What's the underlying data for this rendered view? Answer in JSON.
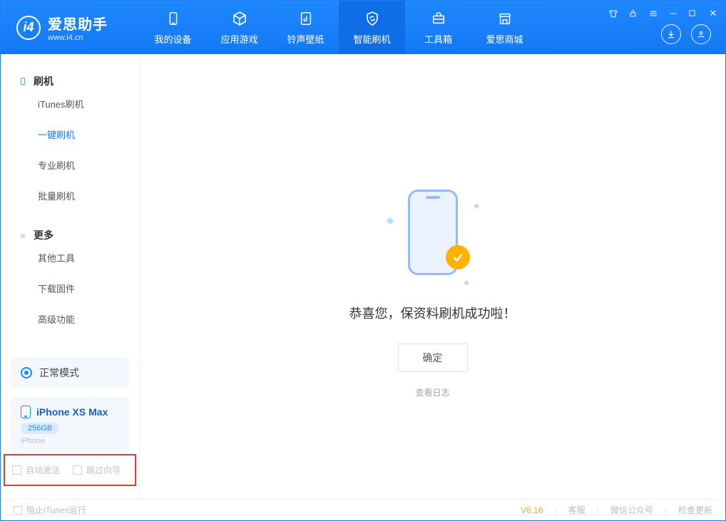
{
  "app": {
    "title": "爱思助手",
    "subtitle": "www.i4.cn"
  },
  "tabs": [
    {
      "label": "我的设备"
    },
    {
      "label": "应用游戏"
    },
    {
      "label": "铃声壁纸"
    },
    {
      "label": "智能刷机"
    },
    {
      "label": "工具箱"
    },
    {
      "label": "爱思商城"
    }
  ],
  "sidebar": {
    "group1": {
      "title": "刷机"
    },
    "items1": [
      {
        "label": "iTunes刷机"
      },
      {
        "label": "一键刷机"
      },
      {
        "label": "专业刷机"
      },
      {
        "label": "批量刷机"
      }
    ],
    "group2": {
      "title": "更多"
    },
    "items2": [
      {
        "label": "其他工具"
      },
      {
        "label": "下载固件"
      },
      {
        "label": "高级功能"
      }
    ],
    "mode": {
      "label": "正常模式"
    },
    "device": {
      "name": "iPhone XS Max",
      "capacity": "256GB",
      "model": "iPhone"
    },
    "options": {
      "autoActivate": "自动激活",
      "skipGuide": "跳过向导"
    }
  },
  "main": {
    "successText": "恭喜您，保资料刷机成功啦！",
    "okBtn": "确定",
    "logLink": "查看日志"
  },
  "footer": {
    "blockItunes": "阻止iTunes运行",
    "version": "V8.16",
    "links": {
      "support": "客服",
      "wechat": "微信公众号",
      "update": "检查更新"
    }
  }
}
